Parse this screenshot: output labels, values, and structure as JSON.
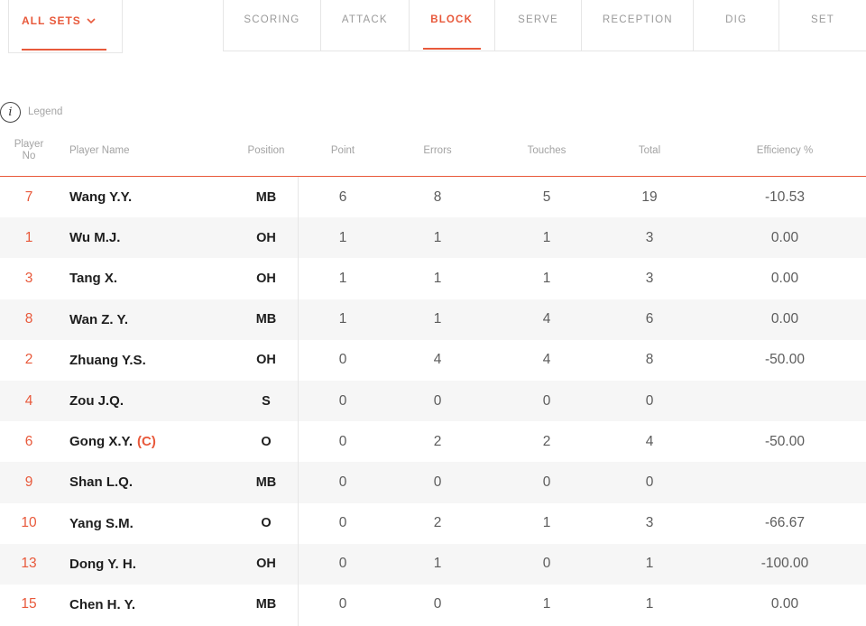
{
  "sets_selector": {
    "label": "ALL SETS"
  },
  "tabs": [
    {
      "label": "SCORING",
      "active": false
    },
    {
      "label": "ATTACK",
      "active": false
    },
    {
      "label": "BLOCK",
      "active": true
    },
    {
      "label": "SERVE",
      "active": false
    },
    {
      "label": "RECEPTION",
      "active": false
    },
    {
      "label": "DIG",
      "active": false
    },
    {
      "label": "SET",
      "active": false
    }
  ],
  "legend": {
    "label": "Legend"
  },
  "columns": {
    "player_no": "Player No",
    "player_name": "Player Name",
    "position": "Position",
    "point": "Point",
    "errors": "Errors",
    "touches": "Touches",
    "total": "Total",
    "efficiency": "Efficiency %"
  },
  "players": [
    {
      "no": "7",
      "name": "Wang Y.Y.",
      "captain": "",
      "position": "MB",
      "point": "6",
      "errors": "8",
      "touches": "5",
      "total": "19",
      "efficiency": "-10.53"
    },
    {
      "no": "1",
      "name": "Wu M.J.",
      "captain": "",
      "position": "OH",
      "point": "1",
      "errors": "1",
      "touches": "1",
      "total": "3",
      "efficiency": "0.00"
    },
    {
      "no": "3",
      "name": "Tang X.",
      "captain": "",
      "position": "OH",
      "point": "1",
      "errors": "1",
      "touches": "1",
      "total": "3",
      "efficiency": "0.00"
    },
    {
      "no": "8",
      "name": "Wan Z. Y.",
      "captain": "",
      "position": "MB",
      "point": "1",
      "errors": "1",
      "touches": "4",
      "total": "6",
      "efficiency": "0.00"
    },
    {
      "no": "2",
      "name": "Zhuang Y.S.",
      "captain": "",
      "position": "OH",
      "point": "0",
      "errors": "4",
      "touches": "4",
      "total": "8",
      "efficiency": "-50.00"
    },
    {
      "no": "4",
      "name": "Zou J.Q.",
      "captain": "",
      "position": "S",
      "point": "0",
      "errors": "0",
      "touches": "0",
      "total": "0",
      "efficiency": ""
    },
    {
      "no": "6",
      "name": "Gong X.Y.",
      "captain": "(C)",
      "position": "O",
      "point": "0",
      "errors": "2",
      "touches": "2",
      "total": "4",
      "efficiency": "-50.00"
    },
    {
      "no": "9",
      "name": "Shan L.Q.",
      "captain": "",
      "position": "MB",
      "point": "0",
      "errors": "0",
      "touches": "0",
      "total": "0",
      "efficiency": ""
    },
    {
      "no": "10",
      "name": "Yang S.M.",
      "captain": "",
      "position": "O",
      "point": "0",
      "errors": "2",
      "touches": "1",
      "total": "3",
      "efficiency": "-66.67"
    },
    {
      "no": "13",
      "name": "Dong Y. H.",
      "captain": "",
      "position": "OH",
      "point": "0",
      "errors": "1",
      "touches": "0",
      "total": "1",
      "efficiency": "-100.00"
    },
    {
      "no": "15",
      "name": "Chen H. Y.",
      "captain": "",
      "position": "MB",
      "point": "0",
      "errors": "0",
      "touches": "1",
      "total": "1",
      "efficiency": "0.00"
    }
  ],
  "colors": {
    "accent": "#e8593b",
    "row_alt": "#f6f6f6",
    "muted": "#a3a3a3"
  }
}
